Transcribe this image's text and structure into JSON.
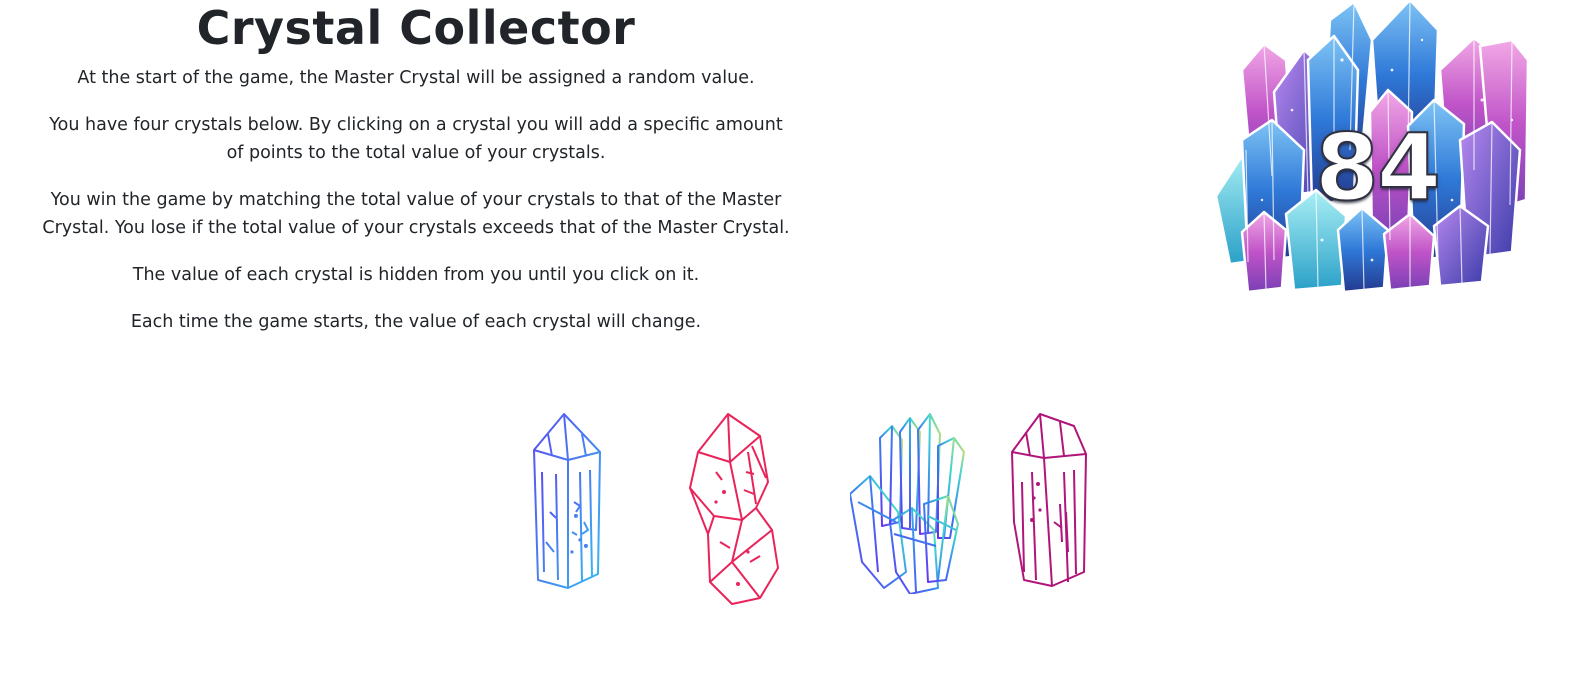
{
  "game": {
    "title": "Crystal Collector",
    "rules": [
      "At the start of the game, the Master Crystal will be assigned a random value.",
      "You have four crystals below. By clicking on a crystal you will add a specific amount of points to the total value of your crystals.",
      "You win the game by matching the total value of your crystals to that of the Master Crystal. You lose if the total value of your crystals exceeds that of the Master Crystal.",
      "The value of each crystal is hidden from you until you click on it.",
      "Each time the game starts, the value of each crystal will change."
    ],
    "master_crystal": {
      "value": "84",
      "icon": "crystal-cluster-icon"
    },
    "crystals": [
      {
        "icon": "blue-crystal-icon",
        "color": "#4a6cf7"
      },
      {
        "icon": "red-crystal-icon",
        "color": "#e8245a"
      },
      {
        "icon": "rainbow-crystal-cluster-icon",
        "color": "#3ec6e8"
      },
      {
        "icon": "magenta-crystal-icon",
        "color": "#b0157a"
      }
    ]
  },
  "colors": {
    "text": "#212529",
    "background": "#ffffff",
    "master_pink": "#d06ad8",
    "master_blue": "#3f8fe6",
    "master_teal": "#45c9d6"
  }
}
